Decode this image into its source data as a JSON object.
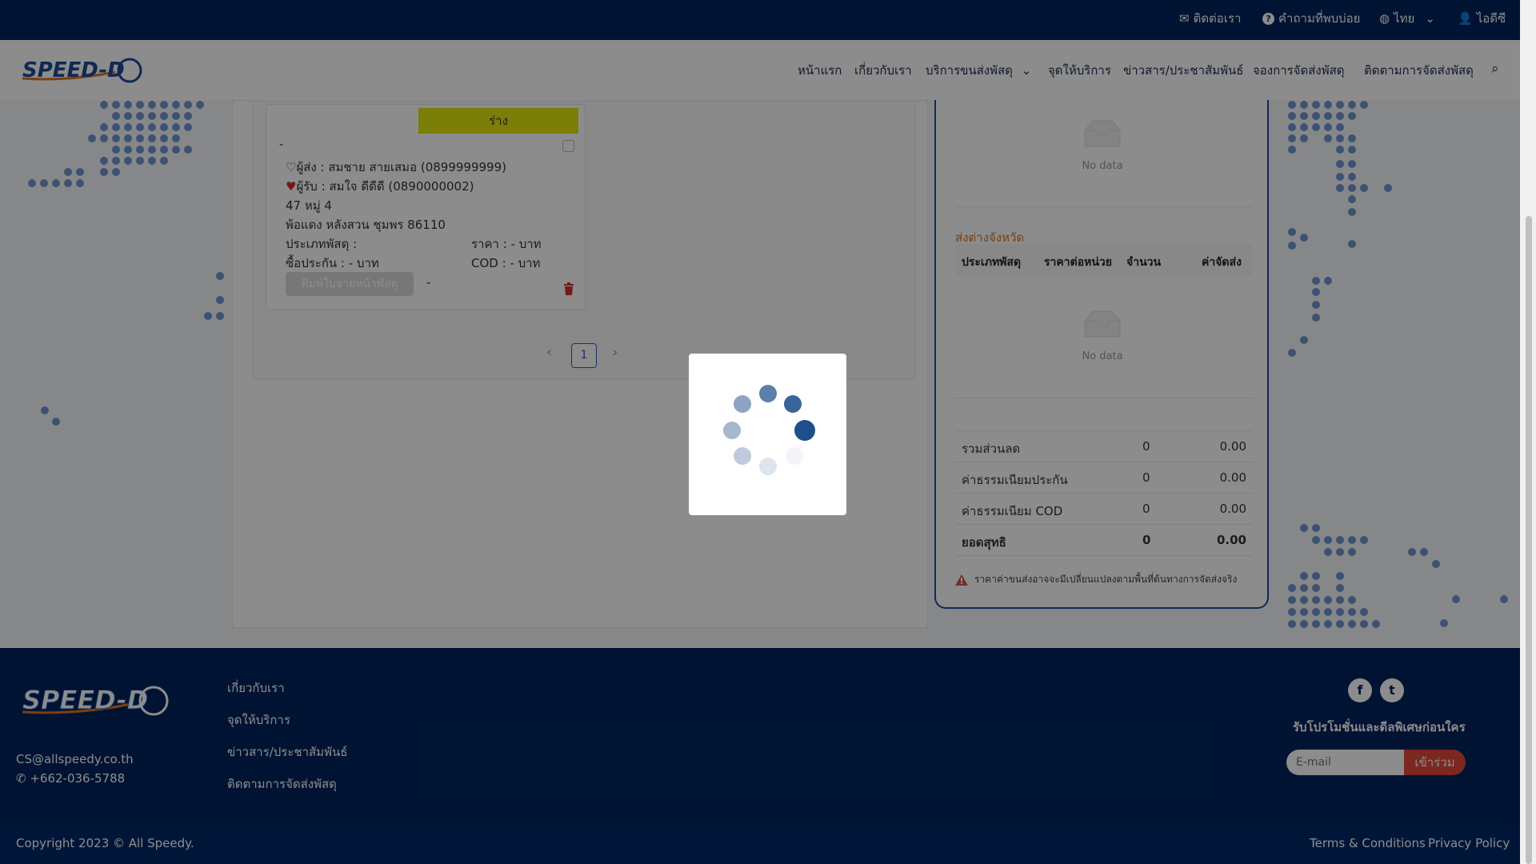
{
  "topbar": {
    "contact": "ติดต่อเรา",
    "faq": "คำถามที่พบบ่อย",
    "language": "ไทย",
    "user": "ไอดีซี"
  },
  "nav": {
    "logo_text": "SPEED-D",
    "items": [
      "หน้าแรก",
      "เกี่ยวกับเรา",
      "บริการขนส่งพัสดุ",
      "จุดให้บริการ",
      "ข่าวสาร/ประชาสัมพันธ์",
      "จองการจัดส่งพัสดุ",
      "ติดตามการจัดส่งพัสดุ"
    ]
  },
  "parcel": {
    "status": "ร่าง",
    "ref": "-",
    "sender_label": "ผู้ส่ง :",
    "sender_value": "สมชาย สายเสมอ (0899999999)",
    "receiver_label": "ผู้รับ :",
    "receiver_value": "สมใจ ดีดีดี (0890000002)",
    "address_line1": "47 หมู่ 4",
    "address_line2": "พ้อแดง หลังสวน ชุมพร 86110",
    "type_label": "ประเภทพัสดุ :",
    "price_label": "ราคา : - บาท",
    "insurance_label": "ซื้อประกัน : - บาท",
    "cod_label": "COD : - บาท",
    "print_button": "พิมพ์ใบจ่ายหน้าพัสดุ",
    "print_note": "-"
  },
  "pagination": {
    "current": "1"
  },
  "summary": {
    "nodata_1": "No data",
    "section_title": "ส่งต่างจังหวัด",
    "headers": [
      "ประเภทพัสดุ",
      "ราคาต่อหน่วย",
      "จำนวน",
      "ค่าจัดส่ง"
    ],
    "nodata_2": "No data",
    "rows": [
      {
        "label": "รวมส่วนลด",
        "qty": "0",
        "amount": "0.00"
      },
      {
        "label": "ค่าธรรมเนียมประกัน",
        "qty": "0",
        "amount": "0.00"
      },
      {
        "label": "ค่าธรรมเนียม COD",
        "qty": "0",
        "amount": "0.00"
      },
      {
        "label": "ยอดสุทธิ",
        "qty": "0",
        "amount": "0.00"
      }
    ],
    "warning": "ราคาค่าขนส่งอาจจะมีเปลี่ยนแปลงตามพื้นที่ต้นทางการจัดส่งจริง"
  },
  "footer": {
    "links": [
      "เกี่ยวกับเรา",
      "จุดให้บริการ",
      "ข่าวสาร/ประชาสัมพันธ์",
      "ติดตามการจัดส่งพัสดุ"
    ],
    "email": "CS@allspeedy.co.th",
    "phone": "+662-036-5788",
    "promo_title": "รับโปรโมชั่นและดีลพิเศษก่อนใคร",
    "email_placeholder": "E-mail",
    "join_button": "เข้าร่วม",
    "copyright": "Copyright 2023 © All Speedy.",
    "terms": "Terms & Conditions",
    "privacy": "Privacy Policy"
  },
  "colors": {
    "navy": "#00245e",
    "status_yellow": "#e1e50d",
    "accent_orange": "#e2741a",
    "join_red": "#e2473b"
  }
}
